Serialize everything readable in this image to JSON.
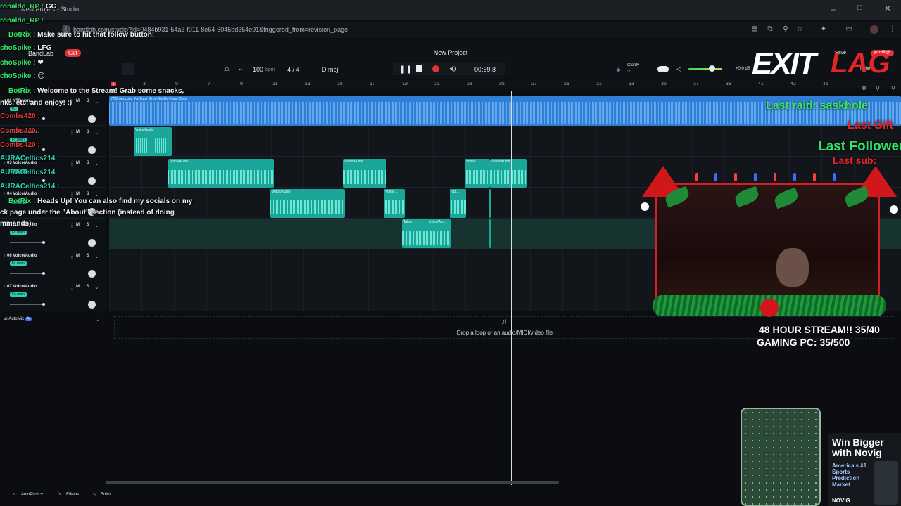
{
  "browser": {
    "url": "bandlab.com/studio?id=0484b931-54a3-f011-8e64-6045bd354e91&triggered_from=revision_page",
    "tab_label": "New Project - Studio"
  },
  "app": {
    "project_title": "New Project",
    "logo": "BandLab",
    "get_label": "Get",
    "save_label": "Save",
    "publish_label": "Publish",
    "invite_label": "Invite"
  },
  "transport": {
    "bpm_value": "100",
    "bpm_unit": "bpm",
    "time_signature": "4 / 4",
    "key": "D moj",
    "time": "00:59.8",
    "clarity_label": "Clarity",
    "clarity_value": "50",
    "volume_db": "+0.0 dB"
  },
  "ruler": {
    "marks": [
      "1",
      "3",
      "5",
      "7",
      "9",
      "11",
      "13",
      "15",
      "17",
      "19",
      "21",
      "23",
      "25",
      "27",
      "29",
      "31",
      "33",
      "35",
      "37",
      "39",
      "41",
      "43",
      "45"
    ]
  },
  "tracks": [
    {
      "number": "01",
      "name": "YTDown...",
      "fx": "Fx"
    },
    {
      "number": "02",
      "name": "Voice/Audio",
      "fx": "Fx main"
    },
    {
      "number": "03",
      "name": "Voice/Audio",
      "fx": "Fx main"
    },
    {
      "number": "04",
      "name": "Voice/Audio",
      "fx": "Fx main"
    },
    {
      "number": "05",
      "name": "Voice/Audio",
      "fx": "Fx main"
    },
    {
      "number": "06",
      "name": "Voice/Audio",
      "fx": "Fx main"
    },
    {
      "number": "07",
      "name": "Voice/Audio",
      "fx": "Fx main"
    }
  ],
  "mute_solo": "M S",
  "clip_labels": {
    "main": "YTDown.com_YouTube_Free-Bio-Do-Yang-Og-s",
    "voice": "Voice/Audio",
    "voice_short": "Voice/...",
    "voice_tiny": "Voi...",
    "takes": "Takes",
    "voice_re": "Voice/Au..."
  },
  "automix": {
    "label": "AutoMix",
    "badge": "AI"
  },
  "drop_zone": "Drop a loop or an audio/MIDI/video file",
  "bottom_bar": {
    "autopitch": "AutoPitch™",
    "effects": "Effects",
    "editor": "Editor"
  },
  "chat": [
    {
      "user": "ronaldo_RP",
      "msg": "GG"
    },
    {
      "user": "ronaldo_RP",
      "msg": ""
    },
    {
      "user": "BotRix",
      "msg": "Make sure to hit that follow button!"
    },
    {
      "user": "choSpike",
      "msg": "LFG"
    },
    {
      "user": "choSpike",
      "msg": "❤"
    },
    {
      "user": "choSpike",
      "msg": "😊"
    },
    {
      "user": "BotRix",
      "msg": "Welcome to the Stream! Grab some snacks,"
    },
    {
      "user": "",
      "msg": "nks, etc. and enjoy! :)"
    },
    {
      "user": "Combs420",
      "msg": ""
    },
    {
      "user": "Combs420",
      "msg": ""
    },
    {
      "user": "Combs420",
      "msg": ""
    },
    {
      "user": "AURACeltics214",
      "msg": ""
    },
    {
      "user": "AURACeltics214",
      "msg": ""
    },
    {
      "user": "AURACeltics214",
      "msg": ""
    },
    {
      "user": "BotRix",
      "msg": "Heads Up! You can also find my socials on my"
    },
    {
      "user": "",
      "msg": "ck page under the \"About\" section (instead of doing"
    },
    {
      "user": "",
      "msg": "mmands)"
    }
  ],
  "overlay": {
    "logo_exit": "EXIT",
    "logo_lag": "LAG",
    "last_raid": "Last raid: saskhole",
    "last_gift": "Last Gift",
    "last_follower": "Last Follower",
    "last_sub": "Last sub:",
    "stream_goal_1": "48 HOUR STREAM!! 35/40",
    "stream_goal_2": "GAMING PC: 35/500",
    "ad_title": "Win Bigger with Novig",
    "ad_sub": "America's #1 Sports Prediction Market",
    "ad_brand": "NOVIG"
  },
  "colors": {
    "main_clip": "#2f7fd6",
    "voice_clip": "#1aa79a",
    "accent_red": "#e22628",
    "accent_green": "#33e56b"
  }
}
